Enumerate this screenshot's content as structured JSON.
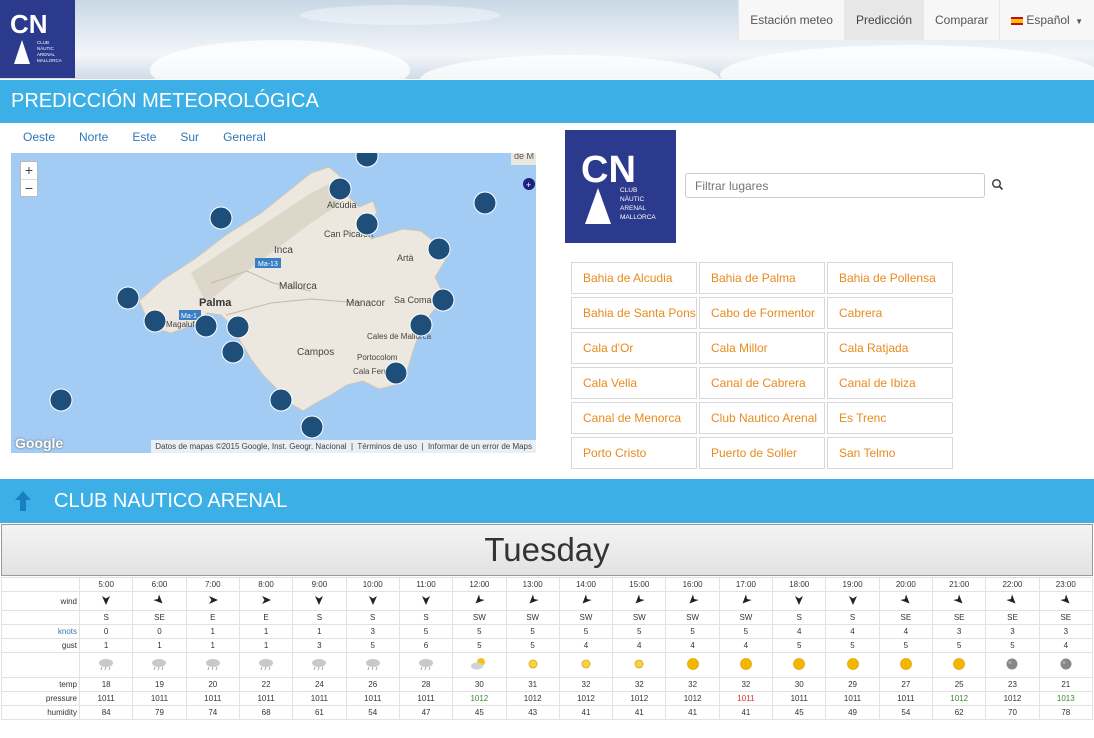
{
  "header": {
    "logo_text": "CNA",
    "logo_subtitle": "CLUB NÀUTIC ARENAL MALLORCA",
    "nav": [
      {
        "label": "Estación meteo",
        "active": false
      },
      {
        "label": "Predicción",
        "active": true
      },
      {
        "label": "Comparar",
        "active": false
      },
      {
        "label": "Español",
        "active": false,
        "dropdown": true
      }
    ]
  },
  "section1": {
    "title": "PREDICCIÓN METEOROLÓGICA"
  },
  "region_tabs": [
    "Oeste",
    "Norte",
    "Este",
    "Sur",
    "General"
  ],
  "map": {
    "zoom_in": "+",
    "zoom_out": "−",
    "attribution": [
      "Datos de mapas ©2015 Google, Inst. Geogr. Nacional",
      "Términos de uso",
      "Informar de un error de Maps"
    ],
    "brand": "Google",
    "labels": [
      "Palma",
      "Inca",
      "Mallorca",
      "Manacor",
      "Campos",
      "Alcúdia",
      "Can Picafort",
      "Artà",
      "Sa Coma",
      "Cales de Mallorca",
      "Portocolom",
      "Cala Ferrera",
      "Magaluf",
      "Ma-13",
      "Ma-1"
    ]
  },
  "search": {
    "placeholder": "Filtrar lugares"
  },
  "places": [
    "Bahia de Alcudia",
    "Bahia de Palma",
    "Bahia de Pollensa",
    "Bahia de Santa Ponsa",
    "Cabo de Formentor",
    "Cabrera",
    "Cala d'Or",
    "Cala Millor",
    "Cala Ratjada",
    "Cala Vella",
    "Canal de Cabrera",
    "Canal de Ibiza",
    "Canal de Menorca",
    "Club Nautico Arenal",
    "Es Trenc",
    "Porto Cristo",
    "Puerto de Soller",
    "San Telmo"
  ],
  "section2": {
    "title": "CLUB NAUTICO ARENAL"
  },
  "forecast": {
    "day": "Tuesday",
    "labels": {
      "wind": "wind",
      "knots": "knots",
      "gust": "gust",
      "temp": "temp",
      "pressure": "pressure",
      "humidity": "humidity"
    },
    "hours": [
      "5:00",
      "6:00",
      "7:00",
      "8:00",
      "9:00",
      "10:00",
      "11:00",
      "12:00",
      "13:00",
      "14:00",
      "15:00",
      "16:00",
      "17:00",
      "18:00",
      "19:00",
      "20:00",
      "21:00",
      "22:00",
      "23:00"
    ],
    "wind_dir": [
      "S",
      "SE",
      "E",
      "E",
      "S",
      "S",
      "S",
      "SW",
      "SW",
      "SW",
      "SW",
      "SW",
      "SW",
      "S",
      "S",
      "SE",
      "SE",
      "SE",
      "SE"
    ],
    "knots": [
      "0",
      "0",
      "1",
      "1",
      "1",
      "3",
      "5",
      "5",
      "5",
      "5",
      "5",
      "5",
      "5",
      "4",
      "4",
      "4",
      "3",
      "3",
      "3"
    ],
    "gust": [
      "1",
      "1",
      "1",
      "1",
      "3",
      "5",
      "6",
      "5",
      "5",
      "4",
      "4",
      "4",
      "4",
      "5",
      "5",
      "5",
      "5",
      "5",
      "4"
    ],
    "sky": [
      "rain",
      "rain",
      "rain",
      "rain",
      "rain",
      "rain",
      "rain",
      "partly-cloudy",
      "sun",
      "sun",
      "sun",
      "sun",
      "sun",
      "sun",
      "sun",
      "sun",
      "sun",
      "moon",
      "moon"
    ],
    "temp": [
      "18",
      "19",
      "20",
      "22",
      "24",
      "26",
      "28",
      "30",
      "31",
      "32",
      "32",
      "32",
      "32",
      "30",
      "29",
      "27",
      "25",
      "23",
      "21"
    ],
    "pressure": [
      "1011",
      "1011",
      "1011",
      "1011",
      "1011",
      "1011",
      "1011",
      "1012",
      "1012",
      "1012",
      "1012",
      "1012",
      "1011",
      "1011",
      "1011",
      "1011",
      "1012",
      "1012",
      "1013"
    ],
    "humidity": [
      "84",
      "79",
      "74",
      "68",
      "61",
      "54",
      "47",
      "45",
      "43",
      "41",
      "41",
      "41",
      "41",
      "45",
      "49",
      "54",
      "62",
      "70",
      "78"
    ]
  }
}
